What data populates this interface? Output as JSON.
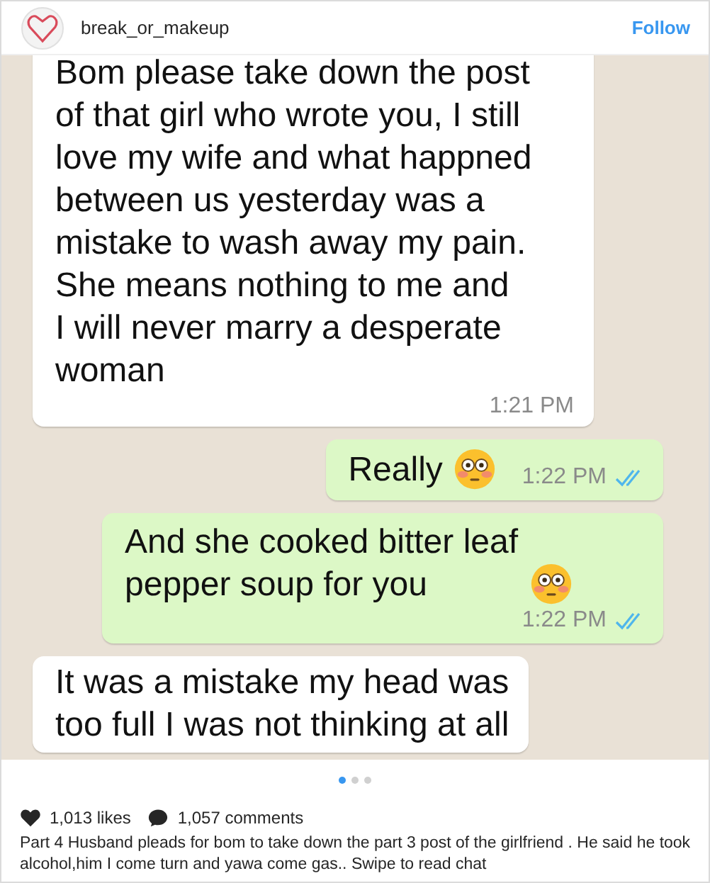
{
  "account": {
    "username": "break_or_makeup",
    "follow_label": "Follow"
  },
  "chat": [
    {
      "kind": "incoming",
      "text": "Bom please take down the post\nof that girl who wrote you, I still\nlove my wife and what happned\nbetween  us yesterday was a\nmistake to wash away my pain.\nShe means nothing to me and\nI will never marry a desperate\nwoman",
      "emoji": false,
      "time": "1:21 PM"
    },
    {
      "kind": "outgoing",
      "text": "Really",
      "emoji": true,
      "time": "1:22 PM",
      "read": true
    },
    {
      "kind": "outgoing",
      "text": "And she cooked bitter leaf\npepper soup for you",
      "emoji": true,
      "time": "1:22 PM",
      "read": true
    },
    {
      "kind": "incoming",
      "text": "It was a mistake my head was\ntoo full I was not thinking at all",
      "emoji": false
    }
  ],
  "carousel": [
    {
      "selected": true
    },
    {
      "selected": false
    },
    {
      "selected": false
    }
  ],
  "likes": "1,013 likes",
  "comments": "1,057 comments",
  "caption": "Part 4 Husband pleads for bom to take down the part 3 post of the girlfriend . He said he took alcohol,him I come turn and yawa come gas.. Swipe to read chat"
}
